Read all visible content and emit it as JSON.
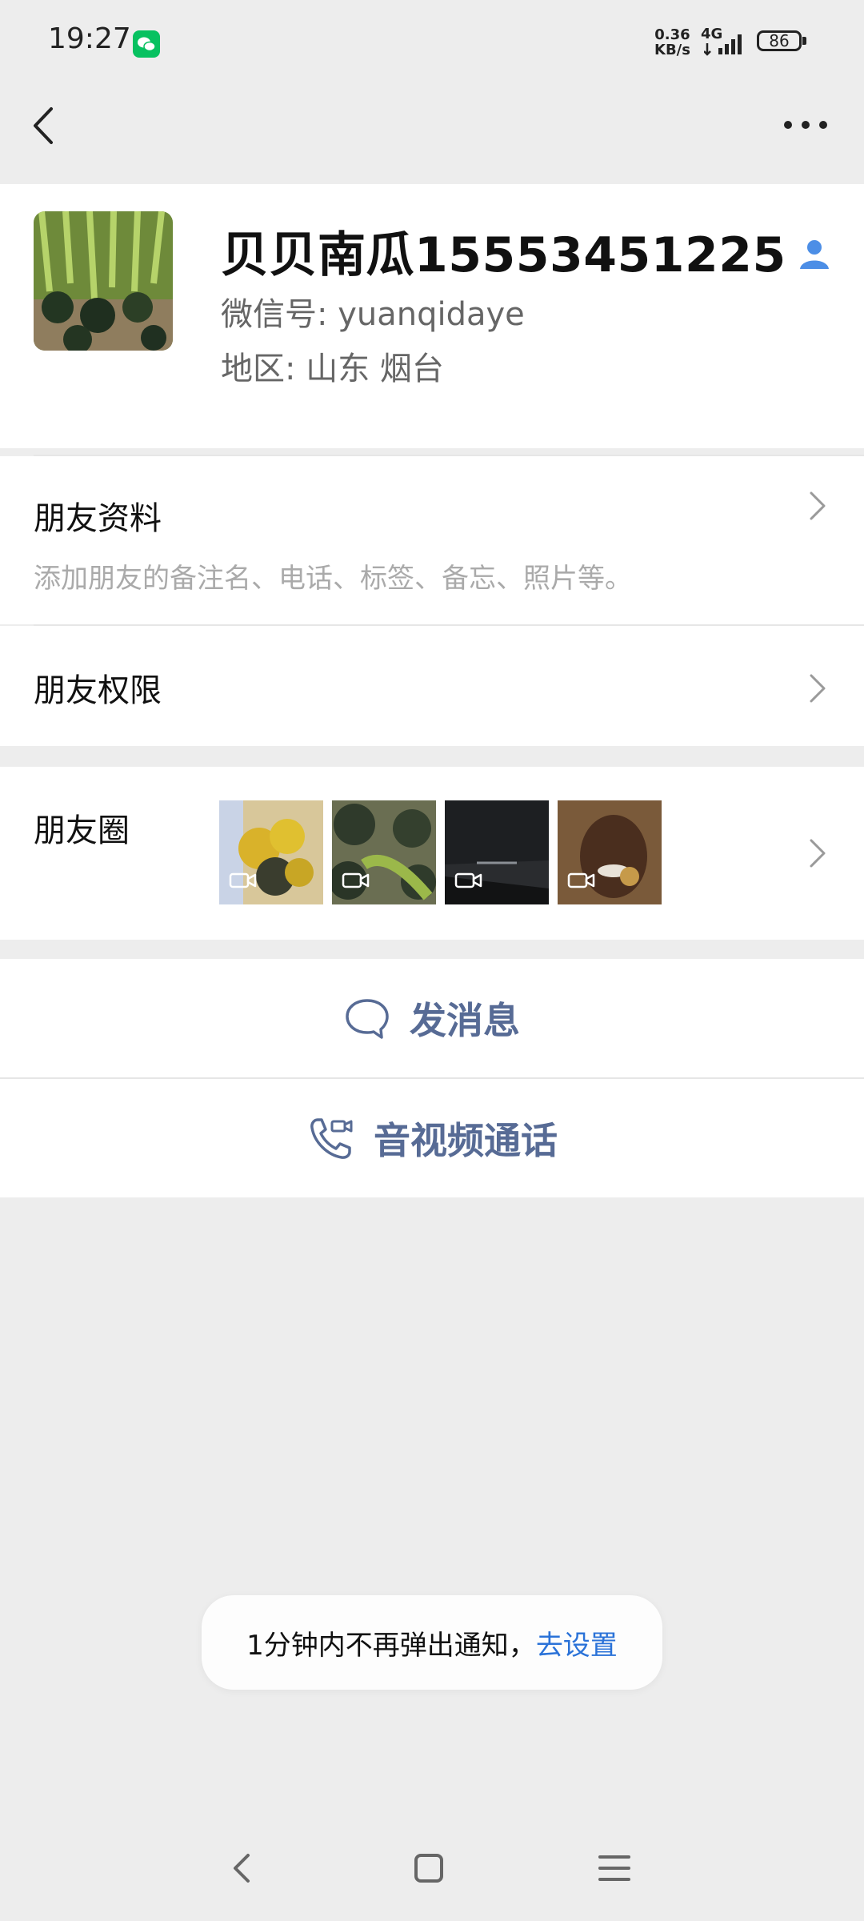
{
  "status_bar": {
    "time": "19:27",
    "net_speed_value": "0.36",
    "net_speed_unit": "KB/s",
    "net_type": "4G",
    "battery": "86",
    "app_notification_icon": "wechat-icon"
  },
  "header": {
    "back_icon": "chevron-left-icon",
    "more_icon": "more-dots-icon"
  },
  "profile": {
    "name": "贝贝南瓜15553451225",
    "wechat_id": "微信号:  yuanqidaye",
    "region": "地区:  山东  烟台",
    "contact_icon": "person-icon"
  },
  "friend_info": {
    "title": "朋友资料",
    "subtitle": "添加朋友的备注名、电话、标签、备忘、照片等。"
  },
  "friend_permissions": {
    "title": "朋友权限"
  },
  "moments": {
    "title": "朋友圈",
    "thumbnails": [
      {
        "icon": "video-camera-icon"
      },
      {
        "icon": "video-camera-icon"
      },
      {
        "icon": "video-camera-icon"
      },
      {
        "icon": "video-camera-icon"
      }
    ]
  },
  "actions": {
    "send_message": "发消息",
    "call": "音视频通话"
  },
  "toast": {
    "text": "1分钟内不再弹出通知，",
    "link": "去设置"
  },
  "colors": {
    "accent": "#576b95",
    "link": "#2a72d8",
    "wechat_green": "#07c160",
    "background": "#ededed"
  }
}
